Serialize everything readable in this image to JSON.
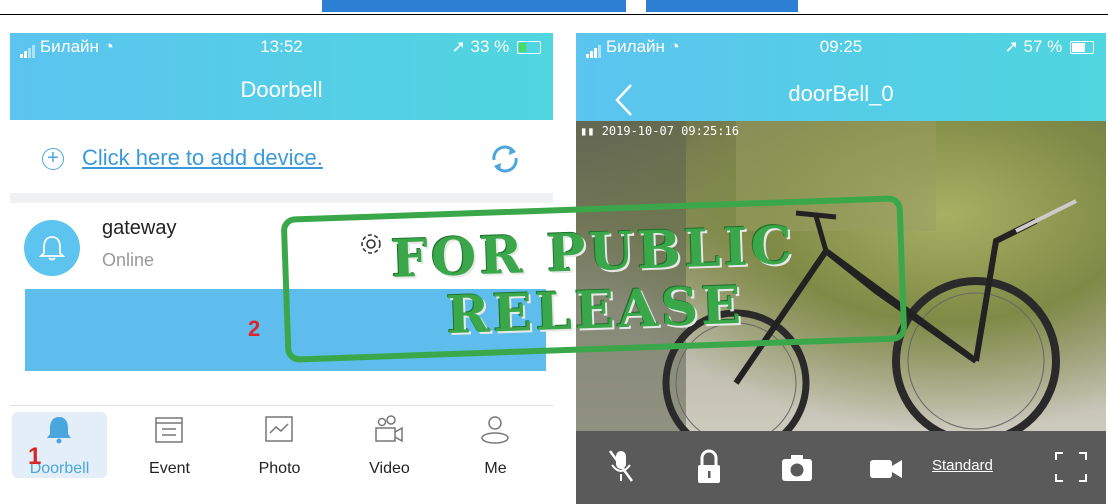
{
  "left_phone": {
    "status": {
      "carrier": "Билайн",
      "time": "13:52",
      "battery": "33 %"
    },
    "title": "Doorbell",
    "add_device_link": "Click here to add device.",
    "device": {
      "name": "gateway",
      "status": "Online"
    },
    "annotation_2": "2",
    "tabs": [
      {
        "label": "Doorbell",
        "icon": "bell-icon",
        "active": true
      },
      {
        "label": "Event",
        "icon": "list-icon",
        "active": false
      },
      {
        "label": "Photo",
        "icon": "photo-icon",
        "active": false
      },
      {
        "label": "Video",
        "icon": "video-icon",
        "active": false
      },
      {
        "label": "Me",
        "icon": "person-icon",
        "active": false
      }
    ],
    "annotation_1": "1"
  },
  "right_phone": {
    "status": {
      "carrier": "Билайн",
      "time": "09:25",
      "battery": "57 %"
    },
    "title": "doorBell_0",
    "timestamp": "2019-10-07 09:25:16",
    "controls": [
      "mute-mic-icon",
      "unlock-icon",
      "camera-icon",
      "record-icon"
    ],
    "quality_label": "Standard"
  },
  "stamp": {
    "line1": "FOR PUBLIC",
    "line2": "RELEASE"
  },
  "colors": {
    "header": "#5bc4ef",
    "accent": "#4aa6dc",
    "annotation": "#d9262b",
    "stamp": "#3aa84a"
  }
}
